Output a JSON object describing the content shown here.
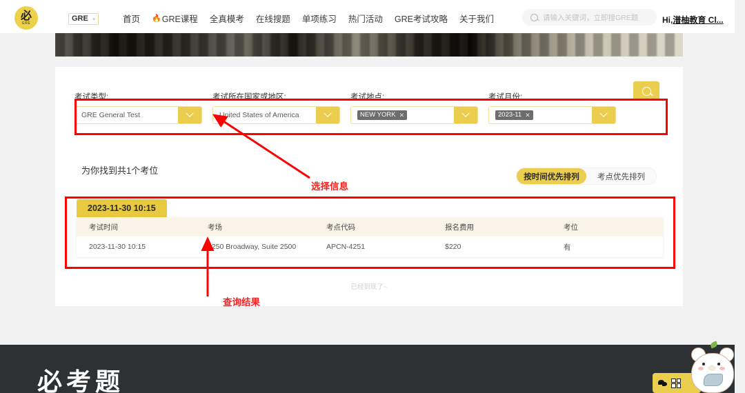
{
  "header": {
    "logo": {
      "char": "必",
      "sub": "GRE"
    },
    "exam_select": {
      "value": "GRE",
      "caret": "▾"
    },
    "nav": [
      {
        "label": "首页",
        "icon": null
      },
      {
        "label": "GRE课程",
        "icon": "fire-icon"
      },
      {
        "label": "全真模考",
        "icon": null
      },
      {
        "label": "在线搜题",
        "icon": null
      },
      {
        "label": "单项练习",
        "icon": null
      },
      {
        "label": "热门活动",
        "icon": null
      },
      {
        "label": "GRE考试攻略",
        "icon": null
      },
      {
        "label": "关于我们",
        "icon": null
      }
    ],
    "search": {
      "placeholder": "请输入关键词，立即搜GRE题",
      "icon": "search-icon"
    },
    "user": {
      "greeting": "Hi,",
      "name": "潽柚教育 Cl..."
    }
  },
  "filters": [
    {
      "label": "考试类型:",
      "value": "GRE General Test",
      "type": "text",
      "tags": []
    },
    {
      "label": "考试所在国家或地区:",
      "value": "United States of America",
      "type": "text",
      "tags": []
    },
    {
      "label": "考试地点:",
      "value": "",
      "type": "tags",
      "tags": [
        "NEW YORK"
      ]
    },
    {
      "label": "考试月份:",
      "value": "",
      "type": "tags",
      "tags": [
        "2023-11"
      ]
    }
  ],
  "search_button": {
    "icon": "search-icon",
    "label": ""
  },
  "results": {
    "count_text": "为你找到共1个考位",
    "sort": {
      "options": [
        {
          "label": "按时间优先排列",
          "active": true
        },
        {
          "label": "考点优先排列",
          "active": false
        }
      ]
    },
    "date_tab": "2023-11-30 10:15",
    "columns": [
      "考试时间",
      "考场",
      "考点代码",
      "报名费用",
      "考位"
    ],
    "rows": [
      [
        "2023-11-30 10:15",
        "1250 Broadway, Suite 2500",
        "APCN-4251",
        "$220",
        "有"
      ]
    ],
    "end_text": "已经到底了~"
  },
  "annotations": [
    {
      "name": "选择信息",
      "text": "选择信息"
    },
    {
      "name": "查询结果",
      "text": "查询结果"
    }
  ],
  "footer": {
    "title": "必考题",
    "wechat_chip": {
      "icons": [
        "wechat-icon",
        "qrcode-icon"
      ]
    }
  },
  "colors": {
    "brand_yellow": "#ecce4e",
    "date_tab_yellow": "#e8c93f",
    "table_head": "#faf5e6",
    "annotation_red": "#ff0000",
    "footer_dark": "#2d3134"
  }
}
